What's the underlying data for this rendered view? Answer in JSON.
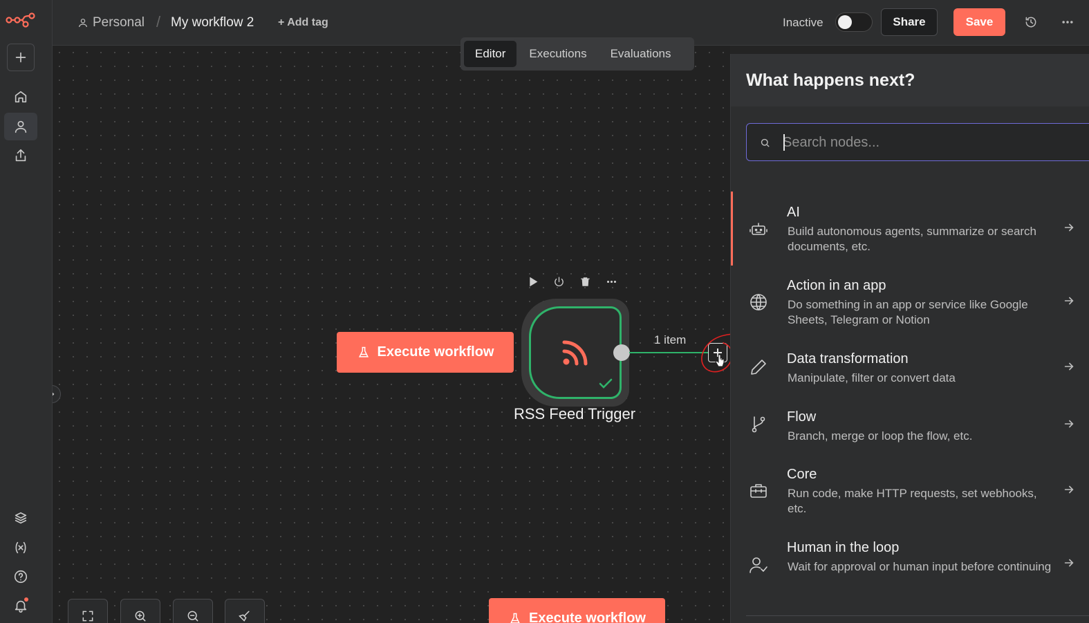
{
  "header": {
    "project": "Personal",
    "separator": "/",
    "workflow_title": "My workflow 2",
    "add_tag": "+ Add tag",
    "status_label": "Inactive",
    "share_label": "Share",
    "save_label": "Save"
  },
  "tabs": [
    {
      "label": "Editor",
      "active": true
    },
    {
      "label": "Executions",
      "active": false
    },
    {
      "label": "Evaluations",
      "active": false
    }
  ],
  "canvas": {
    "execute_label": "Execute workflow",
    "node_label": "RSS Feed Trigger",
    "connection_label": "1 item"
  },
  "panel": {
    "title": "What happens next?",
    "search_placeholder": "Search nodes...",
    "categories": [
      {
        "icon": "robot-icon",
        "title": "AI",
        "desc": "Build autonomous agents, summarize or search documents, etc."
      },
      {
        "icon": "globe-icon",
        "title": "Action in an app",
        "desc": "Do something in an app or service like Google Sheets, Telegram or Notion"
      },
      {
        "icon": "pencil-icon",
        "title": "Data transformation",
        "desc": "Manipulate, filter or convert data"
      },
      {
        "icon": "branch-icon",
        "title": "Flow",
        "desc": "Branch, merge or loop the flow, etc."
      },
      {
        "icon": "toolbox-icon",
        "title": "Core",
        "desc": "Run code, make HTTP requests, set webhooks, etc."
      },
      {
        "icon": "user-check-icon",
        "title": "Human in the loop",
        "desc": "Wait for approval or human input before continuing"
      }
    ]
  },
  "colors": {
    "accent": "#ff6d5a",
    "success": "#2fb36a",
    "focus": "#6f6bd8",
    "background": "#242424",
    "panel": "#2d2e2f"
  }
}
